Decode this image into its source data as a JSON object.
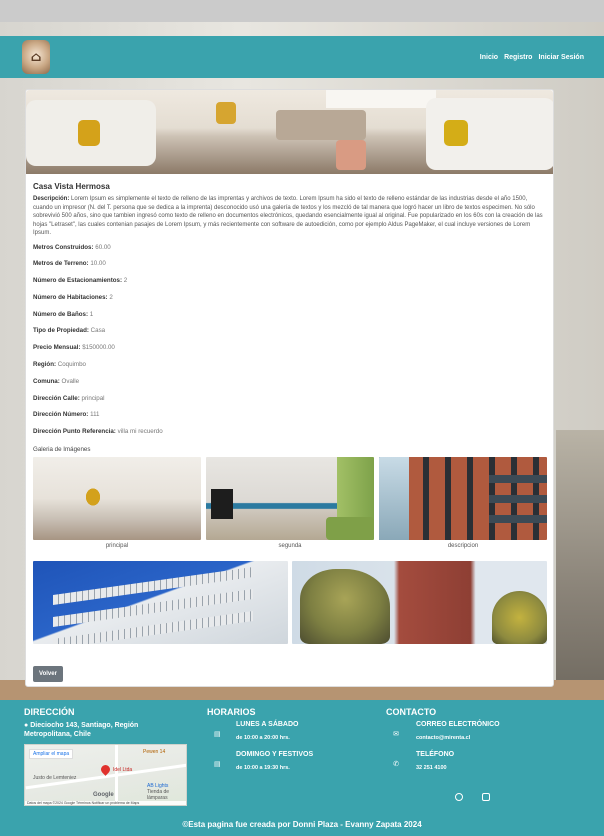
{
  "navbar": {
    "logo_alt": "",
    "links": [
      "Inicio",
      "Registro",
      "Iniciar Sesión"
    ]
  },
  "property": {
    "title": "Casa Vista Hermosa",
    "description_label": "Descripción:",
    "description": "Lorem Ipsum es simplemente el texto de relleno de las imprentas y archivos de texto. Lorem Ipsum ha sido el texto de relleno estándar de las industrias desde el año 1500, cuando un impresor (N. del T. persona que se dedica a la imprenta) desconocido usó una galería de textos y los mezcló de tal manera que logró hacer un libro de textos especimen. No sólo sobrevivió 500 años, sino que tambien ingresó como texto de relleno en documentos electrónicos, quedando esencialmente igual al original. Fue popularizado en los 60s con la creación de las hojas \"Letraset\", las cuales contenian pasajes de Lorem Ipsum, y más recientemente con software de autoedición, como por ejemplo Aldus PageMaker, el cual incluye versiones de Lorem Ipsum.",
    "fields": [
      {
        "label": "Metros Construidos:",
        "value": "60.00"
      },
      {
        "label": "Metros de Terreno:",
        "value": "10.00"
      },
      {
        "label": "Número de Estacionamientos:",
        "value": "2"
      },
      {
        "label": "Número de Habitaciones:",
        "value": "2"
      },
      {
        "label": "Número de Baños:",
        "value": "1"
      },
      {
        "label": "Tipo de Propiedad:",
        "value": "Casa"
      },
      {
        "label": "Precio Mensual:",
        "value": "$150000.00"
      },
      {
        "label": "Región:",
        "value": "Coquimbo"
      },
      {
        "label": "Comuna:",
        "value": "Ovalle"
      },
      {
        "label": "Dirección Calle:",
        "value": "principal"
      },
      {
        "label": "Dirección Número:",
        "value": "111"
      },
      {
        "label": "Dirección Punto Referencia:",
        "value": "villa mi recuerdo"
      }
    ],
    "gallery_title": "Galeria de Imágenes",
    "gallery_captions": [
      "principal",
      "segunda",
      "descripcion"
    ],
    "back_button": "Volver"
  },
  "footer": {
    "direccion_title": "DIRECCIÓN",
    "address": "Dieciocho 143, Santiago, Región Metropolitana, Chile",
    "map": {
      "ampliar": "Ampliar el mapa",
      "labels": [
        "Pewen 14",
        "Idel Ltda",
        "Justo de Lemteniez",
        "AB Lights",
        "Tienda de lámparas"
      ],
      "google": "Google",
      "footnote": "Datos del mapa ©2024 Google   Términos   Notificar un problema de Maps"
    },
    "horarios_title": "HORARIOS",
    "horarios": [
      {
        "label": "LUNES A SÁBADO",
        "value": "de 10:00 a 20:00 hrs."
      },
      {
        "label": "DOMINGO Y FESTIVOS",
        "value": "de 10:00 a 19:30 hrs."
      }
    ],
    "contacto_title": "CONTACTO",
    "contacto": [
      {
        "label": "CORREO ELECTRÓNICO",
        "value": "contacto@mirenta.cl"
      },
      {
        "label": "TELÉFONO",
        "value": "32 251 4100"
      }
    ],
    "copyright": "©Esta pagina fue creada por Donni Plaza - Evanny Zapata 2024"
  }
}
